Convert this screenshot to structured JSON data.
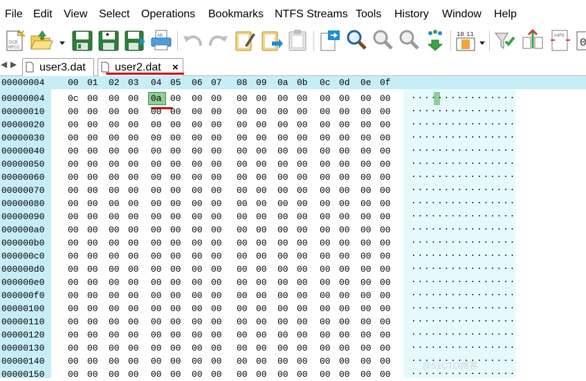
{
  "menu": {
    "items": [
      "File",
      "Edit",
      "View",
      "Select",
      "Operations",
      "Bookmarks",
      "NTFS Streams",
      "Tools",
      "History",
      "Window",
      "Help"
    ]
  },
  "toolbar": {
    "buttons": [
      {
        "name": "new-file-icon",
        "text": "DCB\nNFCC"
      },
      {
        "name": "open-folder-icon",
        "text": ""
      },
      {
        "name": "save-icon",
        "text": ""
      },
      {
        "name": "save-as-icon",
        "text": "*"
      },
      {
        "name": "save-all-icon",
        "text": ""
      },
      {
        "name": "print-icon",
        "text": "AB"
      },
      {
        "name": "undo-icon",
        "text": ""
      },
      {
        "name": "redo-icon",
        "text": ""
      },
      {
        "name": "edit-copy-icon",
        "text": ""
      },
      {
        "name": "paste-icon",
        "text": ""
      },
      {
        "name": "clipboard-icon",
        "text": ""
      },
      {
        "name": "goto-icon",
        "text": ""
      },
      {
        "name": "find-icon",
        "text": ""
      },
      {
        "name": "find-next-icon",
        "text": ""
      },
      {
        "name": "find-prev-icon",
        "text": ""
      },
      {
        "name": "find-replace-icon",
        "text": ""
      },
      {
        "name": "base-converter-icon",
        "text": "10 11"
      },
      {
        "name": "checksum-icon",
        "text": ""
      },
      {
        "name": "compare-icon",
        "text": ""
      },
      {
        "name": "file-compare-icon",
        "text": "A4F8"
      },
      {
        "name": "binary-icon",
        "text": "0"
      }
    ]
  },
  "tabs": {
    "nav_left": "◀",
    "nav_right": "▶",
    "items": [
      {
        "label": "user3.dat",
        "active": false
      },
      {
        "label": "user2.dat",
        "active": true,
        "close": "×"
      }
    ]
  },
  "hex": {
    "current_offset": "00000004",
    "columns": [
      "00",
      "01",
      "02",
      "03",
      "04",
      "05",
      "06",
      "07",
      "08",
      "09",
      "0a",
      "0b",
      "0c",
      "0d",
      "0e",
      "0f"
    ],
    "rows": [
      {
        "address": "00000004",
        "bytes": [
          "0c",
          "00",
          "00",
          "00",
          "0a",
          "00",
          "00",
          "00",
          "00",
          "00",
          "00",
          "00",
          "00",
          "00",
          "00",
          "00"
        ],
        "ascii": "................"
      },
      {
        "address": "00000010",
        "bytes": [
          "00",
          "00",
          "00",
          "00",
          "00",
          "00",
          "00",
          "00",
          "00",
          "00",
          "00",
          "00",
          "00",
          "00",
          "00",
          "00"
        ],
        "ascii": "................"
      },
      {
        "address": "00000020",
        "bytes": [
          "00",
          "00",
          "00",
          "00",
          "00",
          "00",
          "00",
          "00",
          "00",
          "00",
          "00",
          "00",
          "00",
          "00",
          "00",
          "00"
        ],
        "ascii": "................"
      },
      {
        "address": "00000030",
        "bytes": [
          "00",
          "00",
          "00",
          "00",
          "00",
          "00",
          "00",
          "00",
          "00",
          "00",
          "00",
          "00",
          "00",
          "00",
          "00",
          "00"
        ],
        "ascii": "................"
      },
      {
        "address": "00000040",
        "bytes": [
          "00",
          "00",
          "00",
          "00",
          "00",
          "00",
          "00",
          "00",
          "00",
          "00",
          "00",
          "00",
          "00",
          "00",
          "00",
          "00"
        ],
        "ascii": "................"
      },
      {
        "address": "00000050",
        "bytes": [
          "00",
          "00",
          "00",
          "00",
          "00",
          "00",
          "00",
          "00",
          "00",
          "00",
          "00",
          "00",
          "00",
          "00",
          "00",
          "00"
        ],
        "ascii": "................"
      },
      {
        "address": "00000060",
        "bytes": [
          "00",
          "00",
          "00",
          "00",
          "00",
          "00",
          "00",
          "00",
          "00",
          "00",
          "00",
          "00",
          "00",
          "00",
          "00",
          "00"
        ],
        "ascii": "................"
      },
      {
        "address": "00000070",
        "bytes": [
          "00",
          "00",
          "00",
          "00",
          "00",
          "00",
          "00",
          "00",
          "00",
          "00",
          "00",
          "00",
          "00",
          "00",
          "00",
          "00"
        ],
        "ascii": "................"
      },
      {
        "address": "00000080",
        "bytes": [
          "00",
          "00",
          "00",
          "00",
          "00",
          "00",
          "00",
          "00",
          "00",
          "00",
          "00",
          "00",
          "00",
          "00",
          "00",
          "00"
        ],
        "ascii": "................"
      },
      {
        "address": "00000090",
        "bytes": [
          "00",
          "00",
          "00",
          "00",
          "00",
          "00",
          "00",
          "00",
          "00",
          "00",
          "00",
          "00",
          "00",
          "00",
          "00",
          "00"
        ],
        "ascii": "................"
      },
      {
        "address": "000000a0",
        "bytes": [
          "00",
          "00",
          "00",
          "00",
          "00",
          "00",
          "00",
          "00",
          "00",
          "00",
          "00",
          "00",
          "00",
          "00",
          "00",
          "00"
        ],
        "ascii": "................"
      },
      {
        "address": "000000b0",
        "bytes": [
          "00",
          "00",
          "00",
          "00",
          "00",
          "00",
          "00",
          "00",
          "00",
          "00",
          "00",
          "00",
          "00",
          "00",
          "00",
          "00"
        ],
        "ascii": "................"
      },
      {
        "address": "000000c0",
        "bytes": [
          "00",
          "00",
          "00",
          "00",
          "00",
          "00",
          "00",
          "00",
          "00",
          "00",
          "00",
          "00",
          "00",
          "00",
          "00",
          "00"
        ],
        "ascii": "................"
      },
      {
        "address": "000000d0",
        "bytes": [
          "00",
          "00",
          "00",
          "00",
          "00",
          "00",
          "00",
          "00",
          "00",
          "00",
          "00",
          "00",
          "00",
          "00",
          "00",
          "00"
        ],
        "ascii": "................"
      },
      {
        "address": "000000e0",
        "bytes": [
          "00",
          "00",
          "00",
          "00",
          "00",
          "00",
          "00",
          "00",
          "00",
          "00",
          "00",
          "00",
          "00",
          "00",
          "00",
          "00"
        ],
        "ascii": "................"
      },
      {
        "address": "000000f0",
        "bytes": [
          "00",
          "00",
          "00",
          "00",
          "00",
          "00",
          "00",
          "00",
          "00",
          "00",
          "00",
          "00",
          "00",
          "00",
          "00",
          "00"
        ],
        "ascii": "................"
      },
      {
        "address": "00000100",
        "bytes": [
          "00",
          "00",
          "00",
          "00",
          "00",
          "00",
          "00",
          "00",
          "00",
          "00",
          "00",
          "00",
          "00",
          "00",
          "00",
          "00"
        ],
        "ascii": "................"
      },
      {
        "address": "00000110",
        "bytes": [
          "00",
          "00",
          "00",
          "00",
          "00",
          "00",
          "00",
          "00",
          "00",
          "00",
          "00",
          "00",
          "00",
          "00",
          "00",
          "00"
        ],
        "ascii": "................"
      },
      {
        "address": "00000120",
        "bytes": [
          "00",
          "00",
          "00",
          "00",
          "00",
          "00",
          "00",
          "00",
          "00",
          "00",
          "00",
          "00",
          "00",
          "00",
          "00",
          "00"
        ],
        "ascii": "................"
      },
      {
        "address": "00000130",
        "bytes": [
          "00",
          "00",
          "00",
          "00",
          "00",
          "00",
          "00",
          "00",
          "00",
          "00",
          "00",
          "00",
          "00",
          "00",
          "00",
          "00"
        ],
        "ascii": "................"
      },
      {
        "address": "00000140",
        "bytes": [
          "00",
          "00",
          "00",
          "00",
          "00",
          "00",
          "00",
          "00",
          "00",
          "00",
          "00",
          "00",
          "00",
          "00",
          "00",
          "00"
        ],
        "ascii": "................"
      },
      {
        "address": "00000150",
        "bytes": [
          "00",
          "00",
          "00",
          "00",
          "00",
          "00",
          "00",
          "00",
          "00",
          "00",
          "00",
          "00",
          "00",
          "00",
          "00",
          "00"
        ],
        "ascii": "................"
      }
    ]
  },
  "watermark": "@51CTO博客",
  "colors": {
    "header_bg": "#c7eef6",
    "text_pane_bg": "#e6fafd",
    "selection": "#8fce95",
    "annotation_red": "#d40000"
  }
}
